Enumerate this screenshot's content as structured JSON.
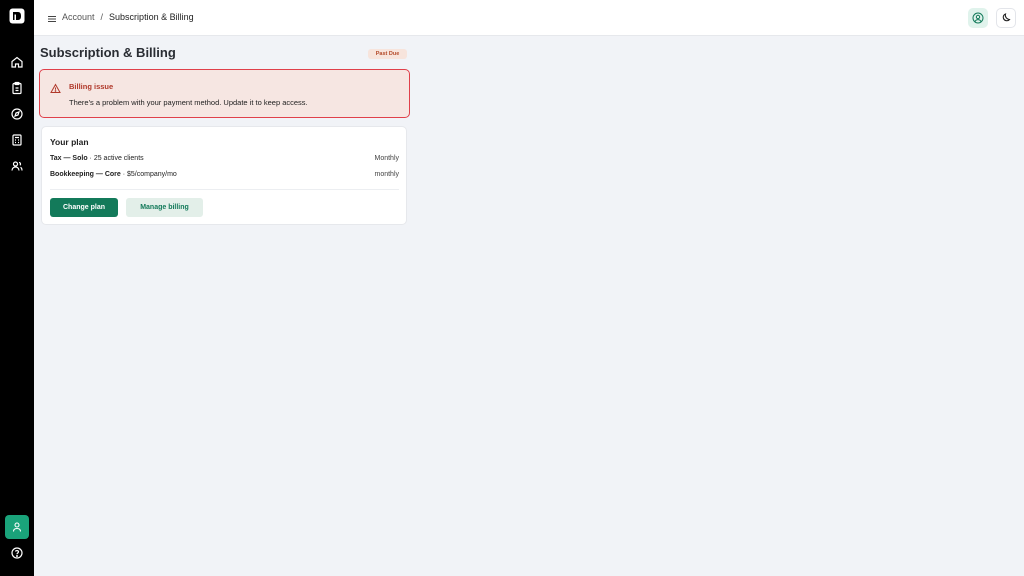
{
  "header": {
    "breadcrumb": {
      "parent": "Account",
      "separator": "/",
      "current": "Subscription & Billing"
    }
  },
  "page": {
    "title": "Subscription & Billing",
    "status_badge": "Past Due"
  },
  "alert": {
    "title": "Billing issue",
    "message": "There's a problem with your payment method. Update it to keep access."
  },
  "plan_card": {
    "title": "Your plan",
    "plans": [
      {
        "name": "Tax — Solo",
        "detail": " · 25 active clients",
        "cycle": "Monthly"
      },
      {
        "name": "Bookkeeping — Core",
        "detail": " · $5/company/mo",
        "cycle": "monthly"
      }
    ],
    "change_plan_label": "Change plan",
    "manage_billing_label": "Manage billing"
  },
  "sidebar": {
    "items": [
      {
        "icon": "home-icon"
      },
      {
        "icon": "clipboard-icon"
      },
      {
        "icon": "compass-icon"
      },
      {
        "icon": "calculator-icon"
      },
      {
        "icon": "users-icon"
      }
    ],
    "bottom": [
      {
        "icon": "user-icon"
      },
      {
        "icon": "help-icon"
      }
    ]
  },
  "colors": {
    "sidebar_bg": "#000000",
    "accent": "#137a5a",
    "alert_border": "#e0404a",
    "alert_bg": "#f6e6e2",
    "badge_text": "#b34a2a"
  }
}
